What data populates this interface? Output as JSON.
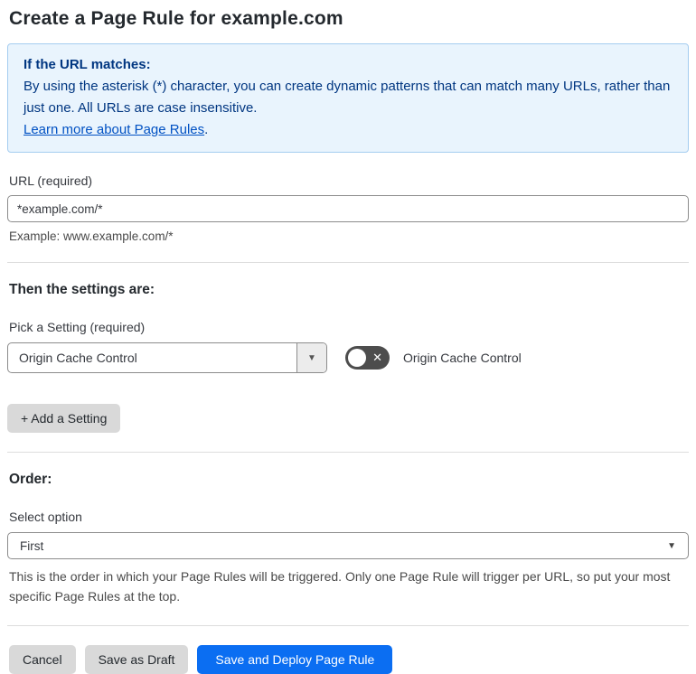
{
  "page": {
    "title": "Create a Page Rule for example.com"
  },
  "info_box": {
    "heading": "If the URL matches:",
    "body": "By using the asterisk (*) character, you can create dynamic patterns that can match many URLs, rather than just one. All URLs are case insensitive.",
    "link_label": "Learn more about Page Rules",
    "link_suffix": "."
  },
  "url_section": {
    "label": "URL (required)",
    "value": "*example.com/*",
    "example": "Example: www.example.com/*"
  },
  "settings_section": {
    "heading": "Then the settings are:",
    "pick_label": "Pick a Setting (required)",
    "selected_setting": "Origin Cache Control",
    "dropdown_caret": "▼",
    "toggle_state": "off",
    "toggle_glyph": "✕",
    "toggle_label": "Origin Cache Control",
    "add_button_label": "+ Add a Setting"
  },
  "order_section": {
    "heading": "Order:",
    "select_label": "Select option",
    "selected_option": "First",
    "select_caret": "▼",
    "help_text": "This is the order in which your Page Rules will be triggered. Only one Page Rule will trigger per URL, so put your most specific Page Rules at the top."
  },
  "footer": {
    "cancel_label": "Cancel",
    "save_draft_label": "Save as Draft",
    "save_deploy_label": "Save and Deploy Page Rule"
  },
  "colors": {
    "accent_blue": "#0b6ef2",
    "info_bg": "#e9f4fd",
    "info_border": "#a5cdf0",
    "info_text": "#003681",
    "link_blue": "#0051c3"
  }
}
